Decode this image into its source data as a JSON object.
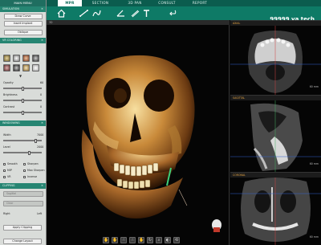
{
  "left_panel": {
    "main_menu": "MAIN MENU",
    "simulation": {
      "title": "SIMULATION",
      "draw_curve": "Draw Curve",
      "insert_implant": "Insert Implant",
      "oblique": "Oblique"
    },
    "vr_coloring": {
      "title": "VR COLORING"
    },
    "opacity": {
      "label": "Opacity",
      "value": "60"
    },
    "brightness": {
      "label": "Brightness",
      "value": "0"
    },
    "contrast": {
      "label": "Contrast",
      "value": "0"
    },
    "windowing": {
      "title": "WINDOWING",
      "width_label": "Width",
      "width_value": "7000",
      "level_label": "Level",
      "level_value": "2000"
    },
    "filters": {
      "smooth": "Smooth",
      "sharpen": "Sharpen",
      "mip": "MIP",
      "max_sharpen": "Max Sharpen",
      "vr": "VR",
      "inverse": "Inverse"
    },
    "clipping": {
      "title": "CLIPPING",
      "dropdown1": "Sagittal",
      "dropdown2": "Clear",
      "right": "Right",
      "left": "Left",
      "apply": "Apply Clipping"
    },
    "change_layout": "Change Layout"
  },
  "toolbar": {
    "tabs": [
      "MPR",
      "SECTION",
      "3D PAN",
      "CONSULT",
      "REPORT"
    ],
    "active_tab": "MPR",
    "brand": "99999 va tech"
  },
  "views": {
    "view3d_label": "3D",
    "axial_label": "AXIAL",
    "sagittal_label": "SAGITTAL",
    "coronal_label": "CORONAL",
    "scale_label": "60 mm"
  },
  "colors": {
    "accent": "#0e7a66",
    "tab_active_text": "#0e6b5a",
    "slice_label": "#e0a040"
  },
  "icons": [
    "pointer-icon",
    "move-icon",
    "line-icon",
    "angle-icon",
    "curve-icon",
    "rotate-icon",
    "zoom-icon",
    "contrast-icon",
    "undo-icon",
    "skull-icon"
  ]
}
